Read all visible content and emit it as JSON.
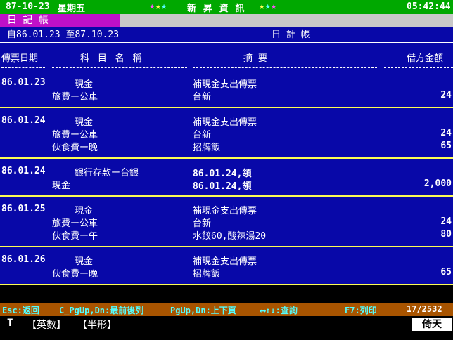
{
  "topbar": {
    "date": "87-10-23",
    "weekday": "星期五",
    "app_name": "新 昇 資 訊",
    "time": "05:42:44",
    "colors": {
      "bg": "#00a800",
      "star_magenta": "#fc54fc",
      "star_yellow": "#fcfc54",
      "star_cyan": "#54fcfc"
    }
  },
  "menu": {
    "label": "日 記 帳"
  },
  "report": {
    "range": "自86.01.23 至87.10.23",
    "title": "日   計   帳",
    "columns": [
      "傳票日期",
      "科  目  名  稱",
      "摘           要",
      "借方金額"
    ],
    "groups": [
      {
        "date": "86.01.23",
        "lines": [
          {
            "account": "現金",
            "summary": "補現金支出傳票",
            "amount": ""
          },
          {
            "account": "旅費ー公車",
            "summary": "台新",
            "amount": "24"
          }
        ]
      },
      {
        "date": "86.01.24",
        "lines": [
          {
            "account": "現金",
            "summary": "補現金支出傳票",
            "amount": ""
          },
          {
            "account": "旅費ー公車",
            "summary": "台新",
            "amount": "24"
          },
          {
            "account": "伙食費ー晚",
            "summary": "招牌飯",
            "amount": "65"
          }
        ]
      },
      {
        "date": "86.01.24",
        "lines": [
          {
            "account": "銀行存款ー台銀",
            "summary": "86.01.24,領",
            "amount": ""
          },
          {
            "account": "現金",
            "summary": "86.01.24,領",
            "amount": "2,000"
          }
        ]
      },
      {
        "date": "86.01.25",
        "lines": [
          {
            "account": "現金",
            "summary": "補現金支出傳票",
            "amount": ""
          },
          {
            "account": "旅費ー公車",
            "summary": "台新",
            "amount": "24"
          },
          {
            "account": "伙食費ー午",
            "summary": "水餃60,酸辣湯20",
            "amount": "80"
          }
        ]
      },
      {
        "date": "86.01.26",
        "lines": [
          {
            "account": "現金",
            "summary": "補現金支出傳票",
            "amount": ""
          },
          {
            "account": "伙食費ー晚",
            "summary": "招牌飯",
            "amount": "65"
          }
        ]
      }
    ]
  },
  "statusbar": {
    "esc": "Esc:返回",
    "cpg": "C_PgUp,Dn:最前後列",
    "pg": "PgUp,Dn:上下頁",
    "arrows": "⟷↑↓:查詢",
    "print": "F7:列印",
    "counter": "17/2532"
  },
  "ime": {
    "mode": "T",
    "eng": "【英數】",
    "half": "【半形】",
    "brand": "倚天"
  }
}
